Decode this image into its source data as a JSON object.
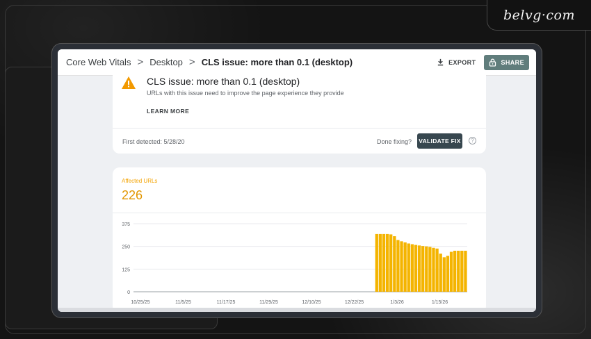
{
  "brand": {
    "logo": "belvg·com"
  },
  "breadcrumb": {
    "items": [
      "Core Web Vitals",
      "Desktop"
    ],
    "current": "CLS issue: more than 0.1 (desktop)",
    "separator": ">"
  },
  "toolbar": {
    "export_label": "EXPORT",
    "share_label": "SHARE"
  },
  "issue": {
    "title": "CLS issue: more than 0.1 (desktop)",
    "subtitle": "URLs with this issue need to improve the page experience they provide",
    "learn_more": "LEARN MORE",
    "first_detected": "First detected: 5/28/20",
    "done_fixing": "Done fixing?",
    "validate_label": "VALIDATE FIX",
    "help_glyph": "?"
  },
  "summary": {
    "label": "Affected URLs",
    "value": "226"
  },
  "colors": {
    "accent": "#f4b400",
    "validate_bg": "#37474f",
    "share_bg": "#607d7c",
    "label_orange": "#f4a300"
  },
  "icons": {
    "warning": "warning-icon",
    "export": "download-icon",
    "share": "lock-icon",
    "help": "help-circle-icon"
  },
  "chart_data": {
    "type": "bar",
    "title": "",
    "xlabel": "",
    "ylabel": "",
    "ylim": [
      0,
      375
    ],
    "yticks": [
      0,
      125,
      250,
      375
    ],
    "xtick_labels": [
      "10/25/25",
      "11/5/25",
      "11/17/25",
      "11/29/25",
      "12/10/25",
      "12/22/25",
      "1/3/26",
      "1/15/26"
    ],
    "grid": true,
    "series": [
      {
        "values": [
          0,
          0,
          0,
          0,
          0,
          0,
          0,
          0,
          0,
          0,
          0,
          0,
          0,
          0,
          0,
          0,
          0,
          0,
          0,
          0,
          0,
          0,
          0,
          0,
          0,
          0,
          0,
          0,
          0,
          0,
          0,
          0,
          0,
          0,
          0,
          0,
          0,
          0,
          0,
          0,
          0,
          0,
          0,
          0,
          0,
          0,
          0,
          0,
          0,
          0,
          0,
          0,
          0,
          0,
          0,
          0,
          0,
          0,
          0,
          0,
          0,
          0,
          0,
          0,
          0,
          0,
          0,
          0,
          318,
          318,
          318,
          318,
          316,
          306,
          285,
          278,
          272,
          266,
          262,
          258,
          255,
          252,
          250,
          247,
          242,
          238,
          210,
          190,
          198,
          220,
          226,
          226,
          226,
          226
        ]
      }
    ]
  }
}
